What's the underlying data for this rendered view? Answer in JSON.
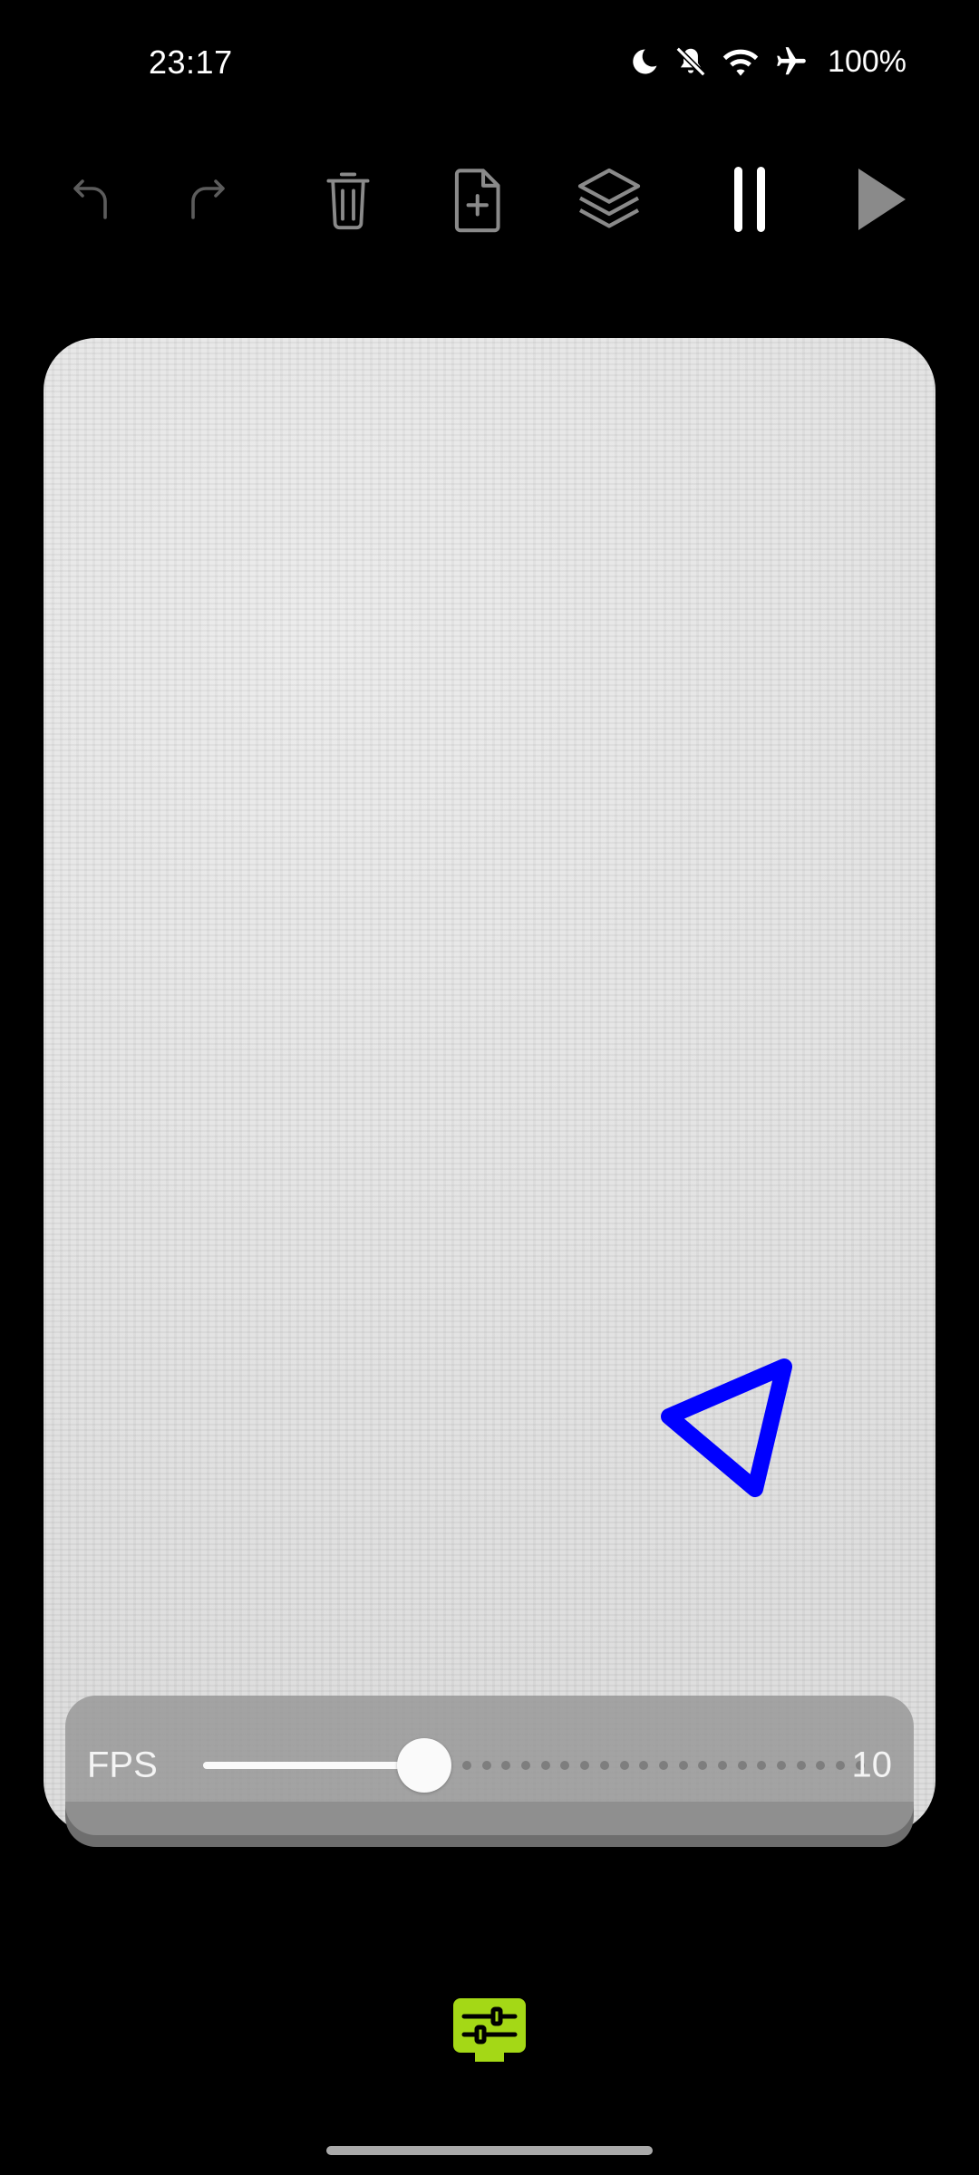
{
  "status_bar": {
    "time": "23:17",
    "battery": "100%",
    "icons": [
      "moon-icon",
      "bell-off-icon",
      "wifi-icon",
      "airplane-icon"
    ]
  },
  "toolbar": {
    "buttons": [
      {
        "name": "undo-icon",
        "enabled": false
      },
      {
        "name": "redo-icon",
        "enabled": false
      },
      {
        "name": "trash-icon",
        "enabled": true
      },
      {
        "name": "file-plus-icon",
        "enabled": true
      },
      {
        "name": "layers-icon",
        "enabled": true
      },
      {
        "name": "pause-icon",
        "enabled": true
      },
      {
        "name": "play-icon",
        "enabled": true
      }
    ]
  },
  "canvas": {
    "background": "#e4e4e4",
    "shape": {
      "type": "triangle",
      "stroke_color": "#0000ff"
    }
  },
  "fps": {
    "label": "FPS",
    "value": "10",
    "slider_fraction": 0.32
  },
  "bottom_bar": {
    "settings_icon": "sliders-icon",
    "accent_color": "#a4d816"
  },
  "colors": {
    "background": "#000000",
    "icon_enabled": "#8a8a8a",
    "icon_disabled": "#5c5c5c"
  }
}
